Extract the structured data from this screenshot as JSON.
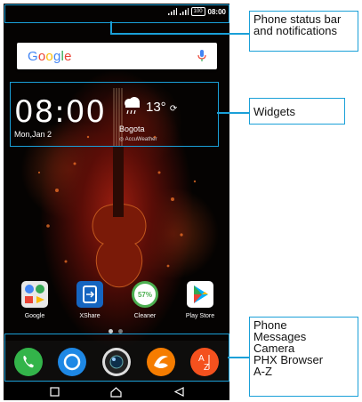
{
  "status_bar": {
    "time": "08:00",
    "battery": "100"
  },
  "search": {
    "logo": "Google"
  },
  "clock": {
    "time": "08:00",
    "date": "Mon,Jan 2"
  },
  "weather": {
    "temperature": "13°",
    "city": "Bogota",
    "provider": "AccuWeather"
  },
  "apps": [
    {
      "label": "Google",
      "icon": "google-folder-icon"
    },
    {
      "label": "XShare",
      "icon": "xshare-icon",
      "color": "#1565c0"
    },
    {
      "label": "Cleaner",
      "icon": "cleaner-icon",
      "badge": "57%",
      "color": "#4caf50"
    },
    {
      "label": "Play Store",
      "icon": "play-store-icon"
    }
  ],
  "dock": [
    {
      "name": "Phone",
      "icon": "phone-icon",
      "color": "#33b44a"
    },
    {
      "name": "Messages",
      "icon": "messages-icon",
      "color": "#1e88e5"
    },
    {
      "name": "Camera",
      "icon": "camera-icon",
      "color": "#222222"
    },
    {
      "name": "PHX Browser",
      "icon": "browser-icon",
      "color": "#f57c00"
    },
    {
      "name": "A-Z",
      "icon": "a-z-icon",
      "color": "#f4511e"
    }
  ],
  "annotations": {
    "status": "Phone status bar and notifications",
    "widgets": "Widgets",
    "dock": [
      "Phone",
      "Messages",
      "Camera",
      "PHX Browser",
      "A-Z"
    ]
  },
  "colors": {
    "callout": "#1aa0d8"
  }
}
